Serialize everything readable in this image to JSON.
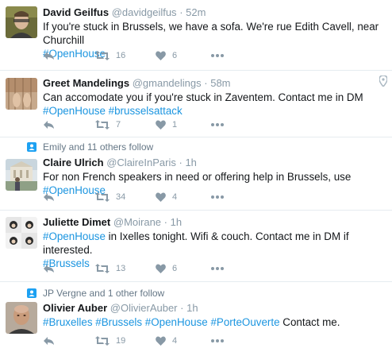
{
  "tweets": [
    {
      "name": "David Geilfus",
      "handle": "@davidgeilfus",
      "time": "52m",
      "text": "If you're stuck in Brussels, we have a sofa. We're rue Edith Cavell, near Churchill",
      "tags": "#OpenHouse",
      "retweets": "16",
      "likes": "6"
    },
    {
      "name": "Greet Mandelings",
      "handle": "@gmandelings",
      "time": "58m",
      "text": "Can accomodate you if you're stuck in Zaventem. Contact me in DM",
      "tag1": "#OpenHouse",
      "tag2": "#brusselsattack",
      "retweets": "7",
      "likes": "1"
    },
    {
      "social": "Emily and 11 others follow",
      "name": "Claire Ulrich",
      "handle": "@ClaireInParis",
      "time": "1h",
      "text": "For non French speakers in need or offering help in Brussels, use",
      "tag": "#OpenHouse",
      "retweets": "34",
      "likes": "4"
    },
    {
      "name": "Juliette Dimet",
      "handle": "@Moirane",
      "time": "1h",
      "tag1": "#OpenHouse",
      "text": "in Ixelles tonight. Wifi & couch. Contact me in DM if interested.",
      "tag2": "#Brussels",
      "retweets": "13",
      "likes": "6"
    },
    {
      "social": "JP Vergne and 1 other follow",
      "name": "Olivier Auber",
      "handle": "@OlivierAuber",
      "time": "1h",
      "tag1": "#Bruxelles",
      "tag2": "#Brussels",
      "tag3": "#OpenHouse",
      "tag4": "#PorteOuverte",
      "text": "Contact me.",
      "retweets": "19",
      "likes": "4"
    }
  ],
  "colors": {
    "link": "#1b95e0",
    "muted": "#8899a6",
    "text": "#14171a"
  },
  "icons": [
    "reply-icon",
    "retweet-icon",
    "like-icon",
    "more-icon",
    "location-pin-icon",
    "follow-badge-icon"
  ]
}
